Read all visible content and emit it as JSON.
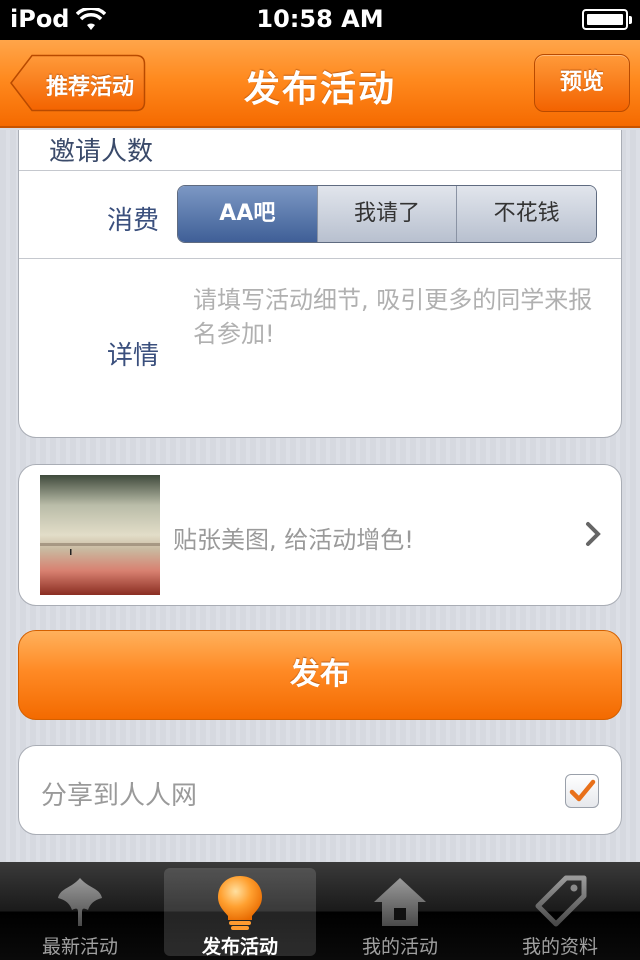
{
  "status_bar": {
    "carrier": "iPod",
    "time": "10:58 AM",
    "icons": [
      "wifi-icon",
      "battery-icon"
    ]
  },
  "nav": {
    "back_label": "推荐活动",
    "title": "发布活动",
    "preview_label": "预览"
  },
  "form": {
    "invite_label": "邀请人数",
    "cost_label": "消费",
    "cost_options": [
      "AA吧",
      "我请了",
      "不花钱"
    ],
    "cost_selected": "AA吧",
    "detail_label": "详情",
    "detail_placeholder": "请填写活动细节, 吸引更多的同学来报名参加!"
  },
  "photo": {
    "prompt": "贴张美图, 给活动增色!"
  },
  "publish_label": "发布",
  "share": {
    "label": "分享到人人网",
    "checked": true
  },
  "tabs": [
    {
      "label": "最新活动",
      "icon": "leaf-icon",
      "active": false
    },
    {
      "label": "发布活动",
      "icon": "lightbulb-icon",
      "active": true
    },
    {
      "label": "我的活动",
      "icon": "home-icon",
      "active": false
    },
    {
      "label": "我的资料",
      "icon": "tag-icon",
      "active": false
    }
  ],
  "colors": {
    "accent": "#f57a10",
    "segment_active": "#4d6aa0",
    "background": "#d9dce3"
  }
}
